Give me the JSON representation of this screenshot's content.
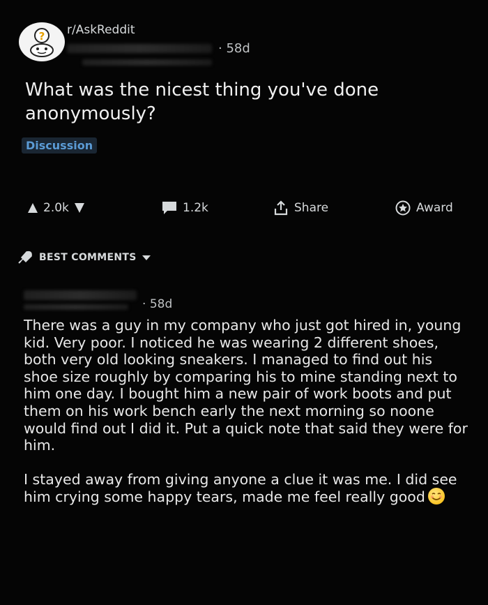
{
  "subreddit": {
    "name": "r/AskReddit",
    "icon": "askreddit-snoo-icon"
  },
  "post": {
    "age": "58d",
    "title": "What was the nicest thing you've done anonymously?",
    "flair": "Discussion"
  },
  "actions": {
    "votes": "2.0k",
    "comments": "1.2k",
    "share": "Share",
    "award": "Award"
  },
  "sort": {
    "label": "BEST COMMENTS"
  },
  "comment": {
    "age": "58d",
    "paragraphs": [
      "There was a guy in my company who just got hired in, young kid. Very poor. I noticed he was wearing 2 different shoes, both very old looking sneakers. I managed to find out his shoe size roughly by comparing his to mine standing next to him one day. I bought him a new pair of work boots and put them on his work bench early the next morning so noone would find out I did it. Put a quick note that said they were for him.",
      "I stayed away from giving anyone a clue it was me. I did see him crying some happy tears, made me feel really good"
    ],
    "emoji": "smiling-face-emoji"
  },
  "colors": {
    "background": "#050505",
    "text": "#d7dadc",
    "flair_text": "#5b9bd5"
  }
}
